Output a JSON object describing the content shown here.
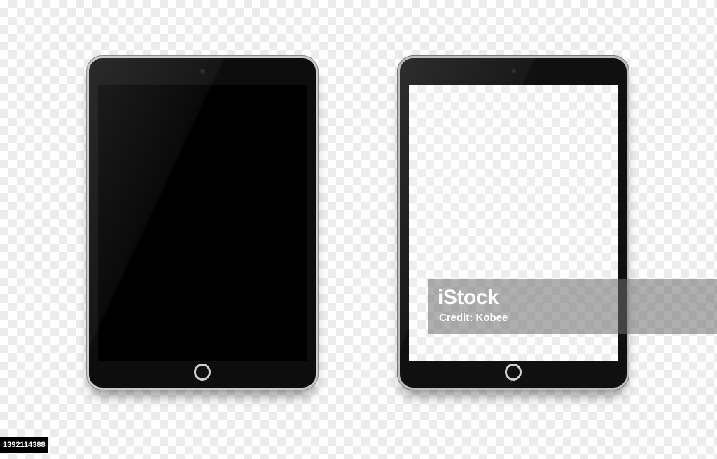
{
  "watermark": {
    "logo_text": "iStock",
    "credit_text": "Credit: Kobee"
  },
  "stock_id": "1392114388",
  "icons": [
    "camera-icon",
    "home-button-icon"
  ],
  "colors": {
    "device_body": "#0d0d0d",
    "device_frame": "#c9c9c9",
    "screen_dark": "#000000"
  }
}
